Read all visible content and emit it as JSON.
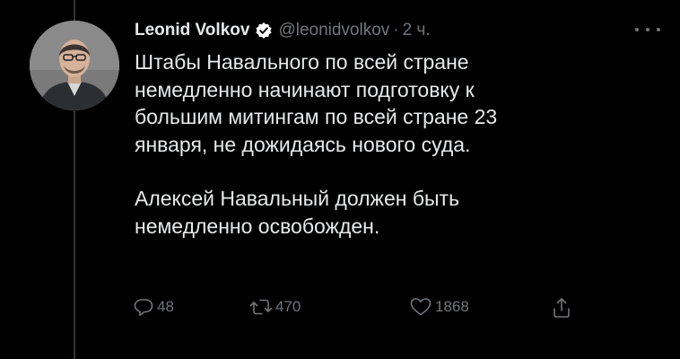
{
  "tweet": {
    "author": {
      "name": "Leonid Volkov",
      "handle": "@leonidvolkov",
      "verified": true
    },
    "separator": "·",
    "time": "2 ч.",
    "paragraphs": [
      "Штабы Навального по всей стране\nнемедленно начинают подготовку к\nбольшим митингам по всей стране 23\nянваря, не дожидаясь нового суда.",
      "Алексей Навальный должен быть\nнемедленно освобожден."
    ],
    "actions": {
      "replies": "48",
      "retweets": "470",
      "likes": "1868"
    }
  },
  "colors": {
    "background": "#000000",
    "text": "#e7e9ea",
    "muted": "#71767b",
    "verified_badge": "#ffffff"
  }
}
